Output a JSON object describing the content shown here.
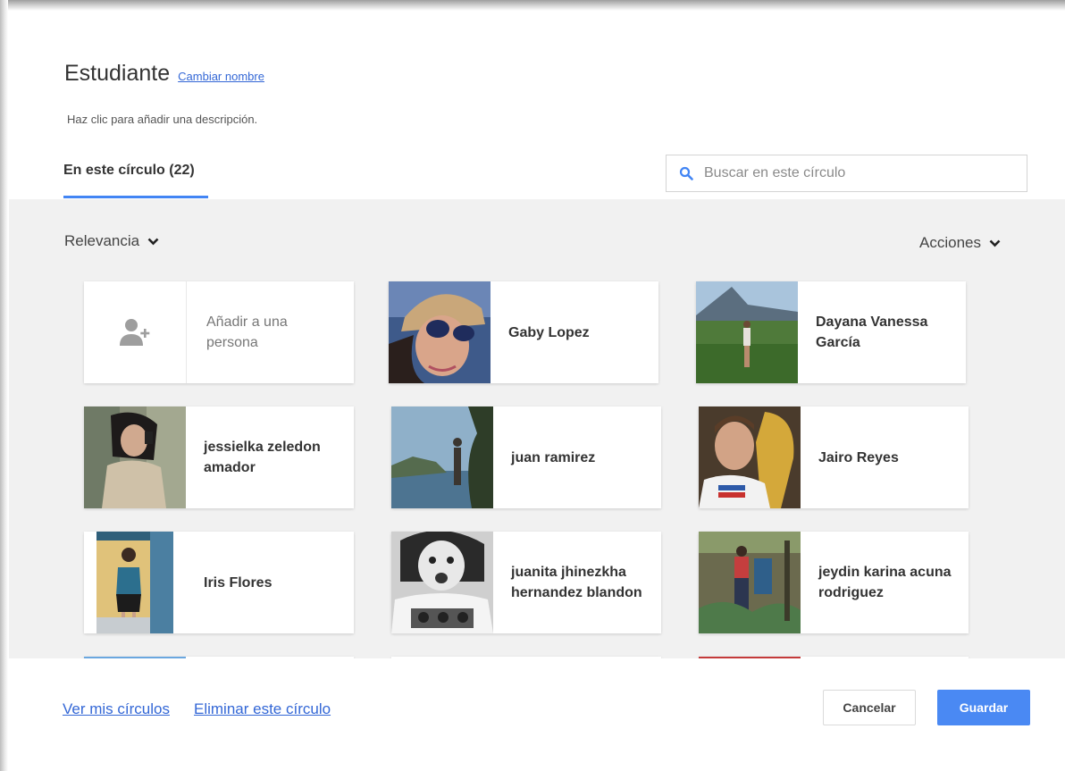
{
  "header": {
    "title": "Estudiante",
    "rename_link": "Cambiar nombre",
    "description_placeholder": "Haz clic para añadir una descripción."
  },
  "tab": {
    "label": "En este círculo (22)"
  },
  "search": {
    "placeholder": "Buscar en este círculo",
    "value": ""
  },
  "toolbar": {
    "sort_label": "Relevancia",
    "actions_label": "Acciones"
  },
  "add_card": {
    "label": "Añadir a una persona"
  },
  "people": [
    {
      "name": "Gaby Lopez"
    },
    {
      "name": "Dayana Vanessa García"
    },
    {
      "name": "jessielka zeledon amador"
    },
    {
      "name": "juan ramirez"
    },
    {
      "name": "Jairo Reyes"
    },
    {
      "name": "Iris Flores"
    },
    {
      "name": "juanita jhinezkha hernandez blandon"
    },
    {
      "name": "jeydin karina acuna rodriguez"
    }
  ],
  "footer": {
    "view_circles_link": "Ver mis círculos",
    "delete_circle_link": "Eliminar este círculo",
    "cancel_label": "Cancelar",
    "save_label": "Guardar"
  },
  "colors": {
    "accent": "#4285f4",
    "link": "#3367d6",
    "save_button": "#4a89f3",
    "panel_bg": "#f1f1f1"
  },
  "icons": {
    "search": "search-icon",
    "dropdown": "chevron-down-icon",
    "add_person": "add-person-icon"
  }
}
